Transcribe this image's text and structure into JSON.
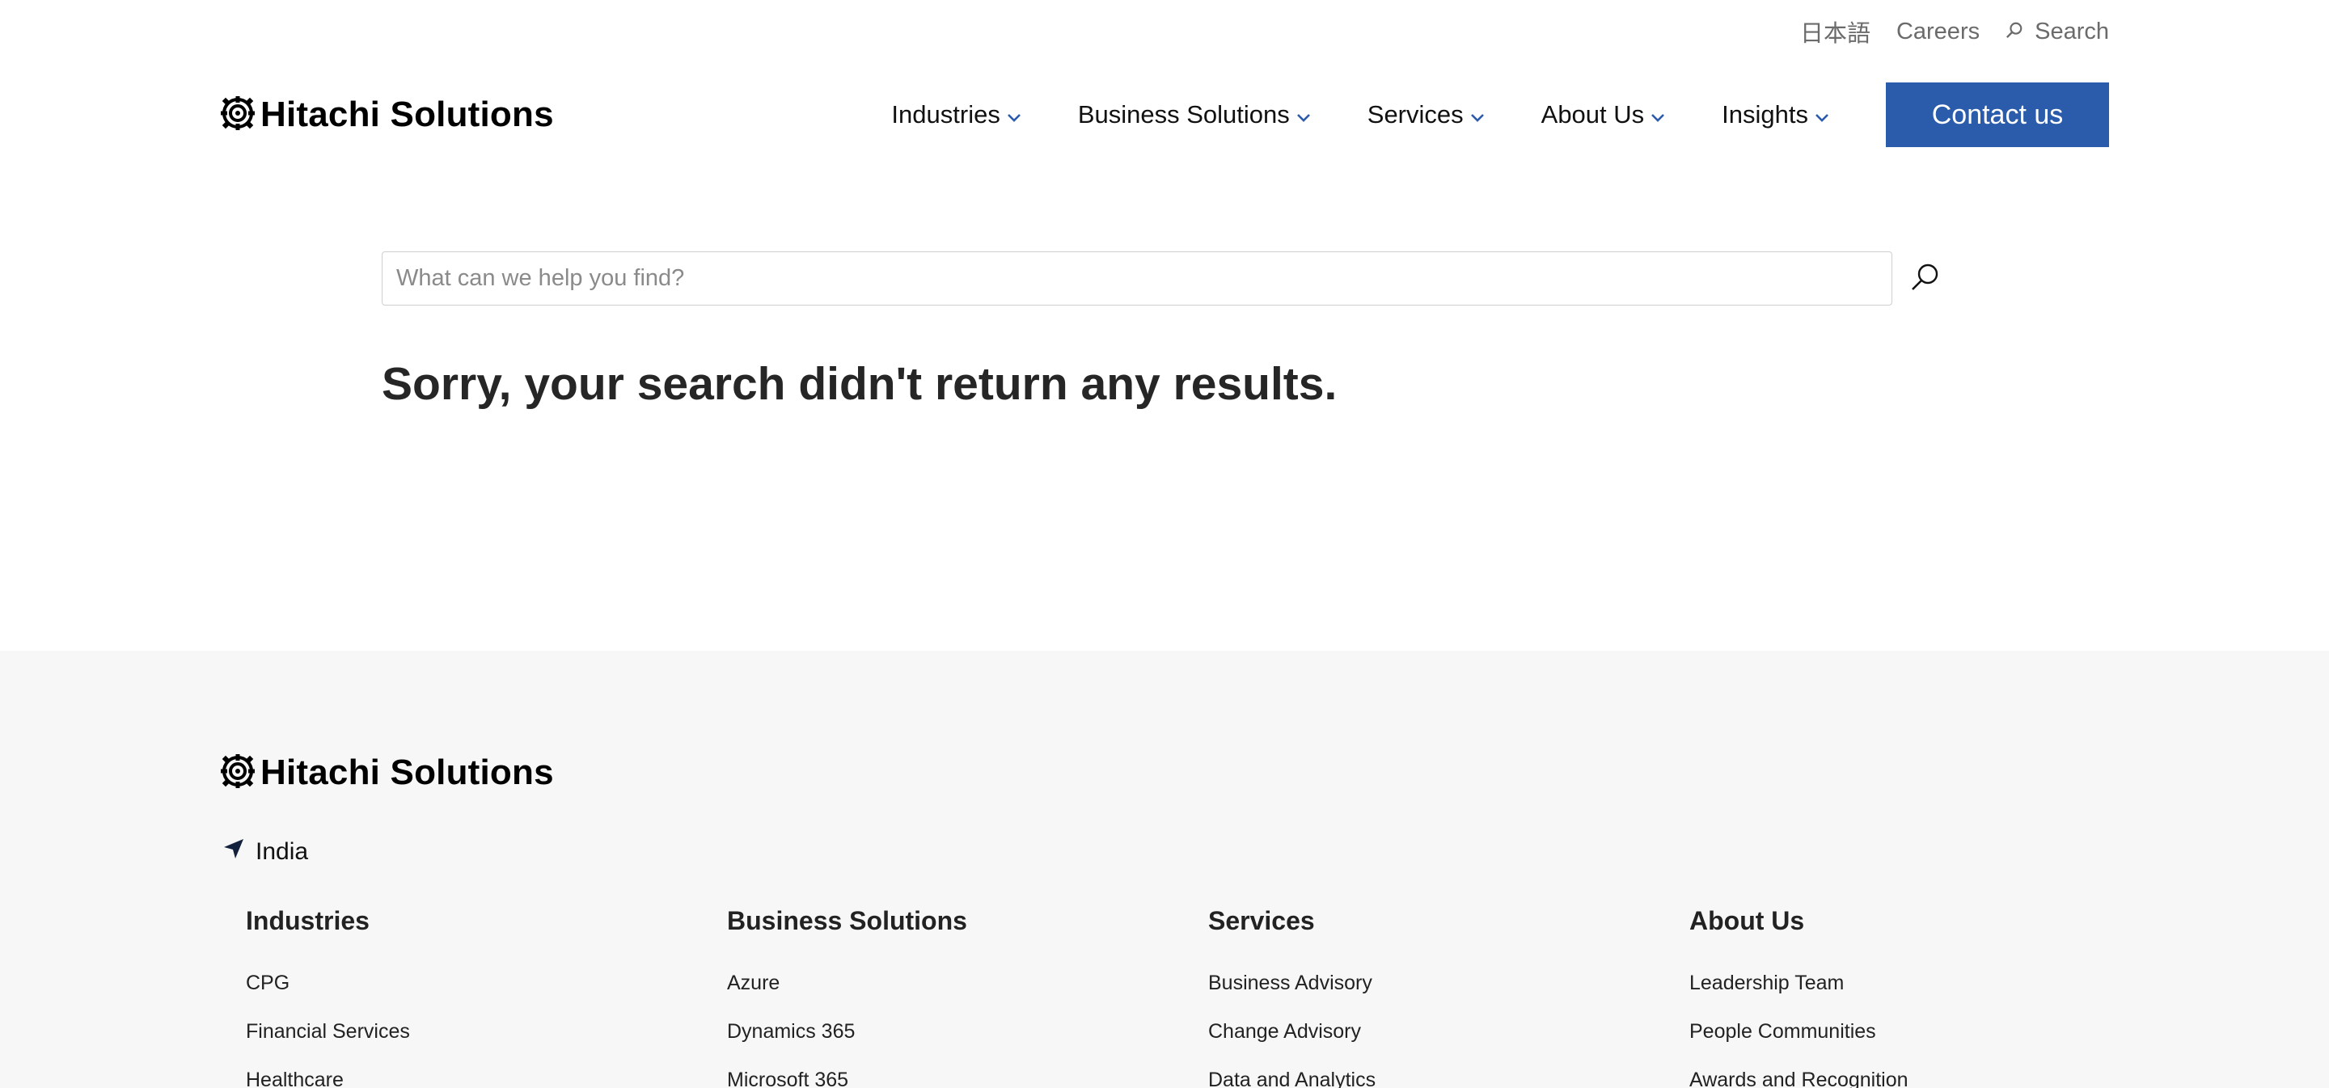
{
  "utility": {
    "language": "日本語",
    "careers": "Careers",
    "search": "Search"
  },
  "brand": {
    "name": "Hitachi Solutions"
  },
  "nav": {
    "items": [
      {
        "label": "Industries"
      },
      {
        "label": "Business Solutions"
      },
      {
        "label": "Services"
      },
      {
        "label": "About Us"
      },
      {
        "label": "Insights"
      }
    ],
    "contact": "Contact us"
  },
  "search": {
    "placeholder": "What can we help you find?",
    "value": "",
    "no_results": "Sorry, your search didn't return any results."
  },
  "footer": {
    "location": "India",
    "columns": [
      {
        "heading": "Industries",
        "links": [
          "CPG",
          "Financial Services",
          "Healthcare"
        ]
      },
      {
        "heading": "Business Solutions",
        "links": [
          "Azure",
          "Dynamics 365",
          "Microsoft 365"
        ]
      },
      {
        "heading": "Services",
        "links": [
          "Business Advisory",
          "Change Advisory",
          "Data and Analytics"
        ]
      },
      {
        "heading": "About Us",
        "links": [
          "Leadership Team",
          "People Communities",
          "Awards and Recognition"
        ]
      }
    ]
  },
  "colors": {
    "accent": "#2b5bab",
    "chevron": "#2b5bab",
    "footer_bg": "#f7f7f7"
  }
}
